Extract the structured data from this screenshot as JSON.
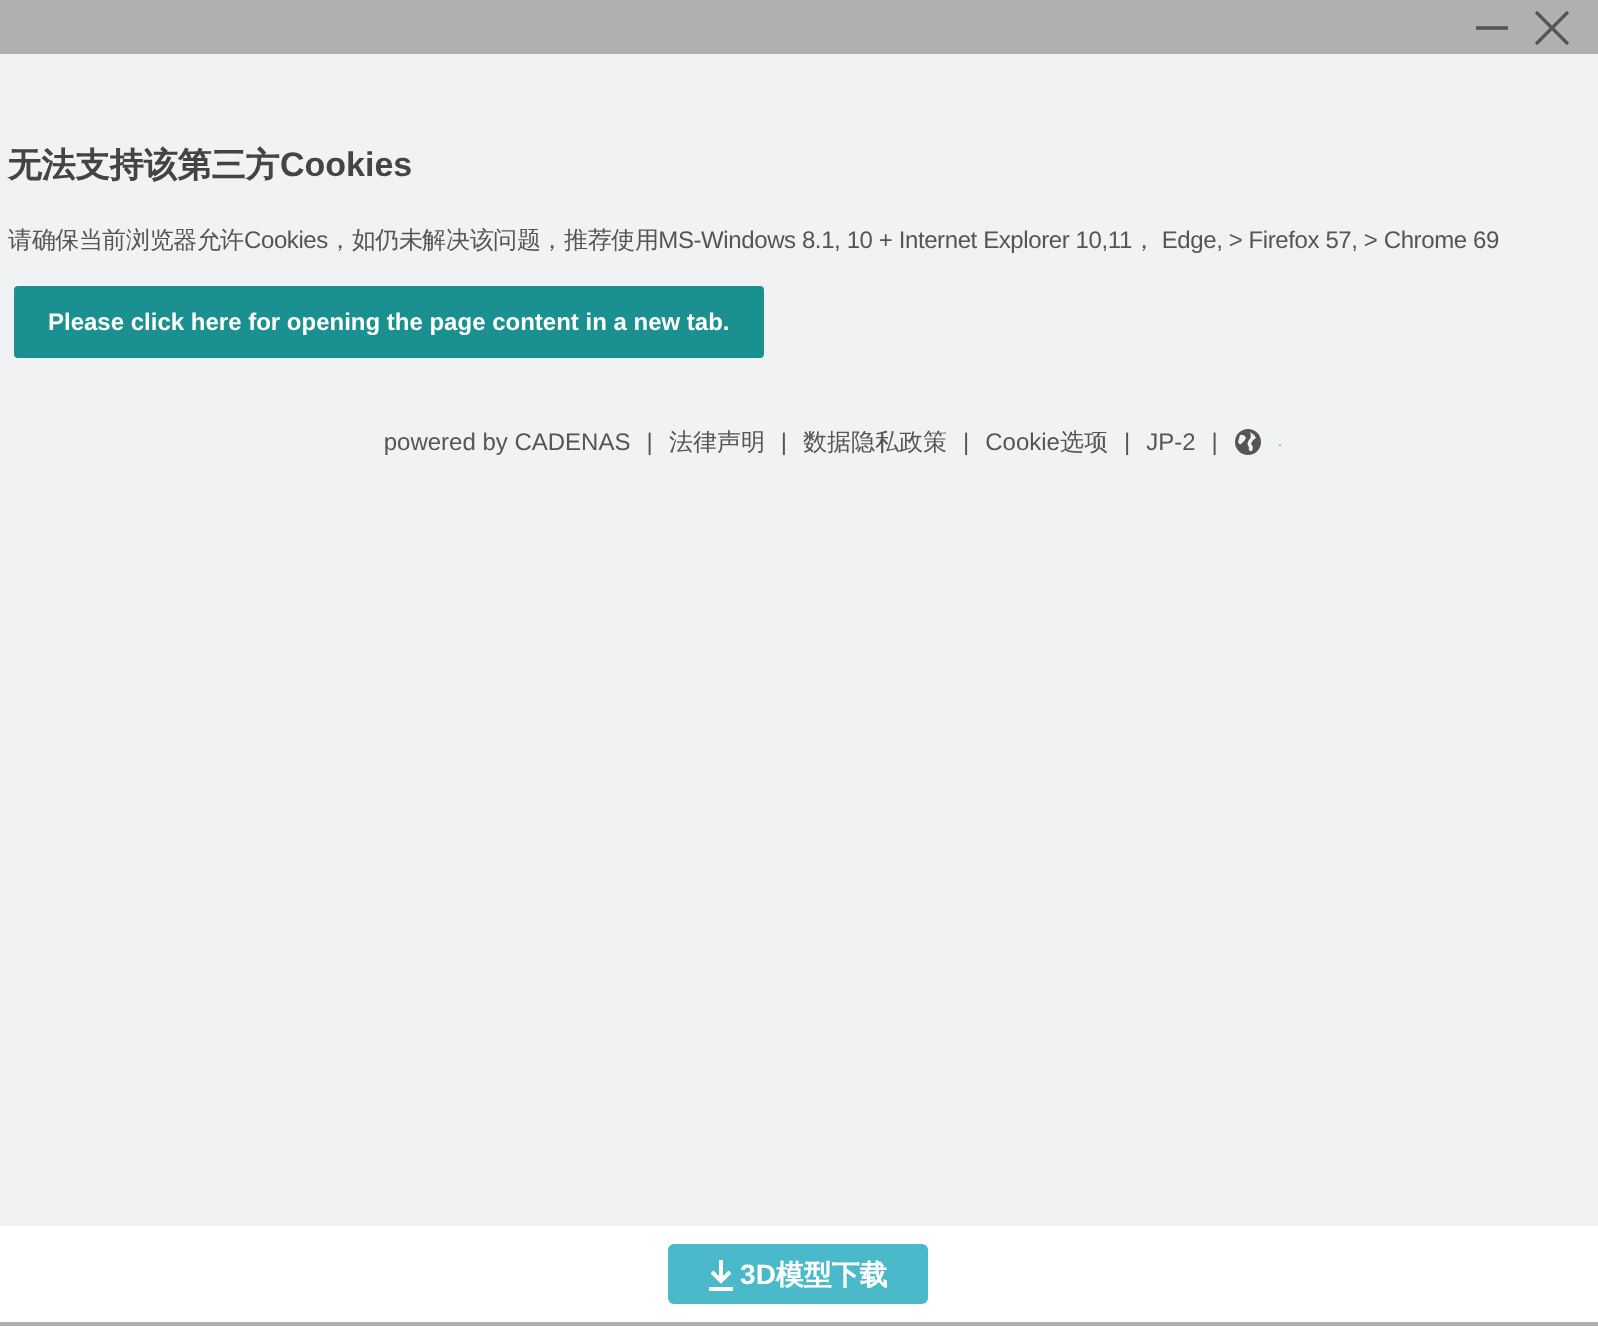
{
  "window": {
    "controls": [
      {
        "kind": "minimize"
      },
      {
        "kind": "close"
      }
    ]
  },
  "message": {
    "title": "无法支持该第三方Cookies",
    "description": "请确保当前浏览器允许Cookies，如仍未解决该问题，推荐使用MS-Windows 8.1, 10 + Internet Explorer 10,11， Edge, > Firefox 57, > Chrome 69",
    "button": "Please click here for opening the page content in a new tab."
  },
  "footer": {
    "separator": "|",
    "items": [
      {
        "kind": "text",
        "label": "powered by CADENAS"
      },
      {
        "kind": "link",
        "label": "法律声明"
      },
      {
        "kind": "link",
        "label": "数据隐私政策"
      },
      {
        "kind": "link",
        "label": "Cookie选项"
      },
      {
        "kind": "link",
        "label": "JP-2"
      },
      {
        "kind": "globe"
      }
    ],
    "trailing": "."
  },
  "bottom_bar": {
    "button": "3D模型下载"
  }
}
